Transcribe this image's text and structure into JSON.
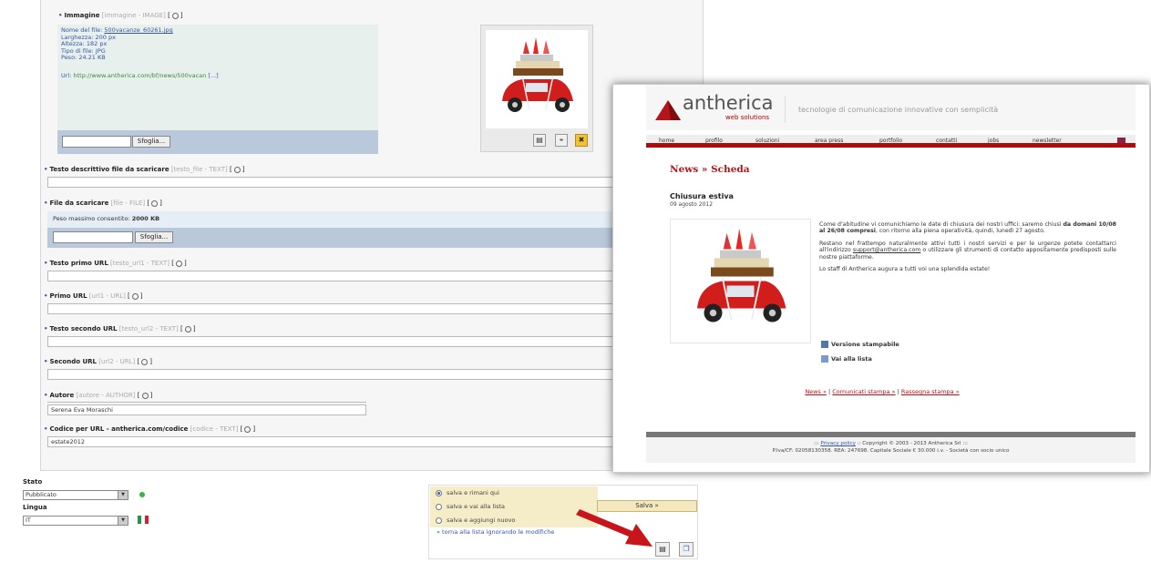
{
  "cms": {
    "image_field": {
      "label": "Immagine",
      "meta": "[immagine - IMAGE]",
      "info": {
        "filename_label": "Nome del file:",
        "filename": "500vacanze_60261.jpg",
        "width_label": "Larghezza:",
        "width": "200 px",
        "height_label": "Altezza:",
        "height": "182 px",
        "type_label": "Tipo di file:",
        "type": "JPG",
        "weight_label": "Peso:",
        "weight": "24.21 KB",
        "url_label": "Url:",
        "url": "http://www.antherica.com/bf/news/500vacan",
        "url_more": "[...]"
      },
      "browse_label": "Sfoglia..."
    },
    "fields": [
      {
        "label": "Testo descrittivo file da scaricare",
        "meta": "[testo_file - TEXT]",
        "value": ""
      },
      {
        "label": "File da scaricare",
        "meta": "[file - FILE]",
        "size_label": "Peso massimo consentito:",
        "size_value": "2000 KB",
        "browse_label": "Sfoglia..."
      },
      {
        "label": "Testo primo URL",
        "meta": "[testo_url1 - TEXT]",
        "value": ""
      },
      {
        "label": "Primo URL",
        "meta": "[url1 - URL]",
        "value": ""
      },
      {
        "label": "Testo secondo URL",
        "meta": "[testo_url2 - TEXT]",
        "value": ""
      },
      {
        "label": "Secondo URL",
        "meta": "[url2 - URL]",
        "value": ""
      },
      {
        "label": "Autore",
        "meta": "[autore - AUTHOR]",
        "value": "Serena Eva Moraschi"
      },
      {
        "label": "Codice per URL - antherica.com/codice",
        "meta": "[codice - TEXT]",
        "value": "estate2012"
      }
    ],
    "state": {
      "stato_label": "Stato",
      "stato_value": "Pubblicato",
      "lingua_label": "Lingua",
      "lingua_value": "IT"
    },
    "save": {
      "options": [
        "salva e rimani qui",
        "salva e vai alla lista",
        "salva e aggiungi nuovo"
      ],
      "selected": 0,
      "cancel_link": "« torna alla lista ignorando le modifiche",
      "save_label": "Salva »"
    }
  },
  "website": {
    "logo": "antherica",
    "logo_sub": "web solutions",
    "tagline": "tecnologie di comunicazione innovative con semplicità",
    "nav": [
      "home",
      "profilo",
      "soluzioni",
      "area press",
      "portfolio",
      "contatti",
      "jobs",
      "newsletter"
    ],
    "heading": "News » Scheda",
    "article_title": "Chiusura estiva",
    "article_date": "09 agosto 2012",
    "p1_a": "Come d'abitudine vi comunichiamo le date di chiusura dei nostri uffici: saremo chiusi ",
    "p1_b": "da domani 10/08 al 26/08 compresi",
    "p1_c": ", con ritorno alla piena operatività, quindi, lunedì 27 agosto.",
    "p2_a": "Restano nel frattempo naturalmente attivi tutti i nostri servizi e per le urgenze potete contattarci all'indirizzo ",
    "p2_link": "support@antherica.com",
    "p2_b": " o utilizzare gli strumenti di contatto appositamente predisposti sulle nostre piattaforme.",
    "p3": "Lo staff di Antherica augura a tutti voi una splendida estate!",
    "link_print": "Versione stampabile",
    "link_list": "Vai alla lista",
    "bottom_links": [
      "News »",
      "Comunicati stampa »",
      "Rassegna stampa »"
    ],
    "footer_line1_a": "::: ",
    "footer_privacy": "Privacy policy",
    "footer_line1_b": " :: Copyright © 2003 - 2013 Antherica Srl :::",
    "footer_line2": "P.Iva/CF: 02058130358. REA: 247698. Capitale Sociale € 30.000 i.v. - Società con socio unico"
  },
  "colors": {
    "brand_red": "#b5151a",
    "nav_underline": "#a90d0d",
    "arrow": "#c8141b"
  }
}
